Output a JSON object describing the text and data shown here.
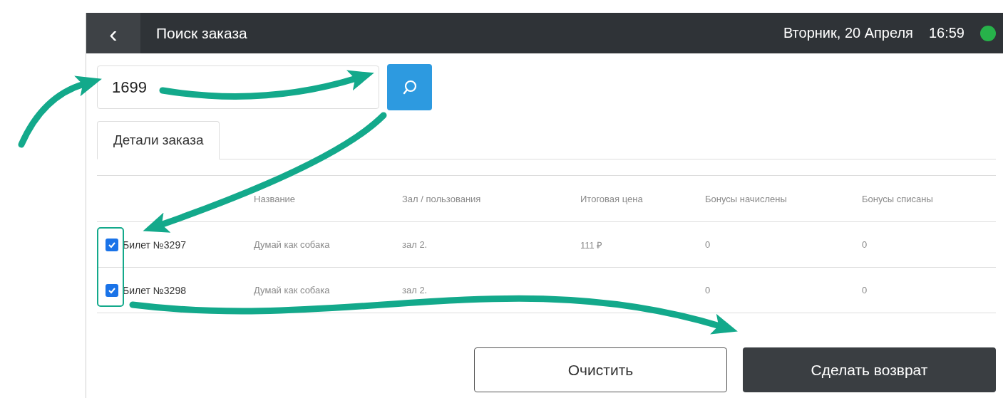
{
  "header": {
    "back": "‹",
    "title": "Поиск заказа",
    "date": "Вторник, 20 Апреля",
    "time": "16:59",
    "online": true
  },
  "search": {
    "value": "1699"
  },
  "tabs": [
    {
      "label": "Детали заказа",
      "selected": true
    }
  ],
  "table": {
    "columns": [
      "",
      "Название",
      "Зал /  пользования",
      "Итоговая цена",
      "Бонусы начислены",
      "Бонусы списаны"
    ],
    "rows": [
      {
        "checked": true,
        "cells": [
          "Билет №3297",
          "Думай как собака",
          "зал 2.",
          "111 ₽",
          "0",
          "0"
        ]
      },
      {
        "checked": true,
        "cells": [
          "Билет №3298",
          "Думай как собака",
          "зал 2.",
          "",
          "0",
          "0"
        ]
      }
    ]
  },
  "buttons": [
    {
      "label": "Очистить",
      "kind": "secondary"
    },
    {
      "label": "Сделать возврат",
      "kind": "primary"
    }
  ]
}
